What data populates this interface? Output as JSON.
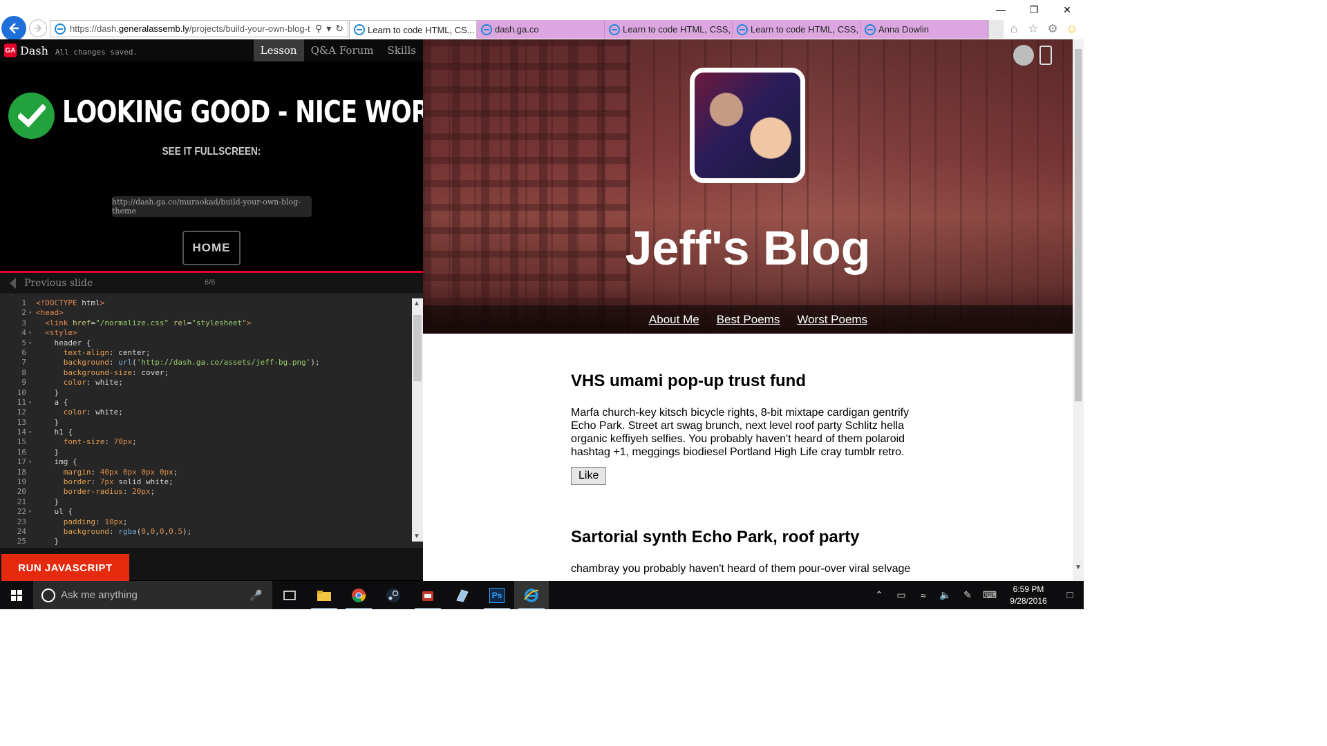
{
  "browser": {
    "url_prefix": "https://dash.",
    "url_domain": "generalassemb.ly",
    "url_path": "/projects/build-your-own-blog-t",
    "tabs": [
      {
        "label": "Learn to code HTML, CS...",
        "active": true
      },
      {
        "label": "dash.ga.co",
        "active": false
      },
      {
        "label": "Learn to code HTML, CSS, a...",
        "active": false
      },
      {
        "label": "Learn to code HTML, CSS, a...",
        "active": false
      },
      {
        "label": "Anna Dowlin",
        "active": false
      }
    ],
    "icons": [
      "home-icon",
      "favorites-star-icon",
      "settings-gear-icon",
      "smiley-feedback-icon"
    ]
  },
  "dash": {
    "logo": "GA",
    "title": "Dash",
    "saved_status": "All changes saved.",
    "nav": [
      "Lesson",
      "Q&A Forum",
      "Skills"
    ],
    "success_title": "LOOKING GOOD - NICE WORK!",
    "see_fullscreen": "SEE IT FULLSCREEN:",
    "fullscreen_url": "http://dash.ga.co/muraokad/build-your-own-blog-theme",
    "home_button": "HOME",
    "prev_slide": "Previous slide",
    "slide_count": "6/6",
    "run_button": "RUN JAVASCRIPT"
  },
  "code_lines": [
    "<!DOCTYPE html>",
    "<head>",
    "  <link href=\"/normalize.css\" rel=\"stylesheet\">",
    "  <style>",
    "    header {",
    "      text-align: center;",
    "      background: url('http://dash.ga.co/assets/jeff-bg.png');",
    "      background-size: cover;",
    "      color: white;",
    "    }",
    "    a {",
    "      color: white;",
    "    }",
    "    h1 {",
    "      font-size: 70px;",
    "    }",
    "    img {",
    "      margin: 40px 0px 0px 0px;",
    "      border: 7px solid white;",
    "      border-radius: 20px;",
    "    }",
    "    ul {",
    "      padding: 10px;",
    "      background: rgba(0,0,0,0.5);",
    "    }"
  ],
  "blog": {
    "title": "Jeff's Blog",
    "nav": [
      "About Me",
      "Best Poems",
      "Worst Poems"
    ],
    "posts": [
      {
        "title": "VHS umami pop-up trust fund",
        "body": "Marfa church-key kitsch bicycle rights, 8-bit mixtape cardigan gentrify Echo Park. Street art swag brunch, next level roof party Schlitz hella organic keffiyeh selfies. You probably haven't heard of them polaroid hashtag +1, meggings biodiesel Portland High Life cray tumblr retro.",
        "button": "Like"
      },
      {
        "title": "Sartorial synth Echo Park, roof party",
        "body": "chambray you probably haven't heard of them pour-over viral selvage"
      }
    ]
  },
  "taskbar": {
    "search_placeholder": "Ask me anything",
    "apps": [
      "task-view-icon",
      "file-explorer-icon",
      "chrome-icon",
      "steam-icon",
      "app-icon",
      "paint-icon",
      "photoshop-icon",
      "internet-explorer-icon"
    ],
    "photoshop_label": "Ps",
    "time": "6:59 PM",
    "date": "9/28/2016"
  }
}
